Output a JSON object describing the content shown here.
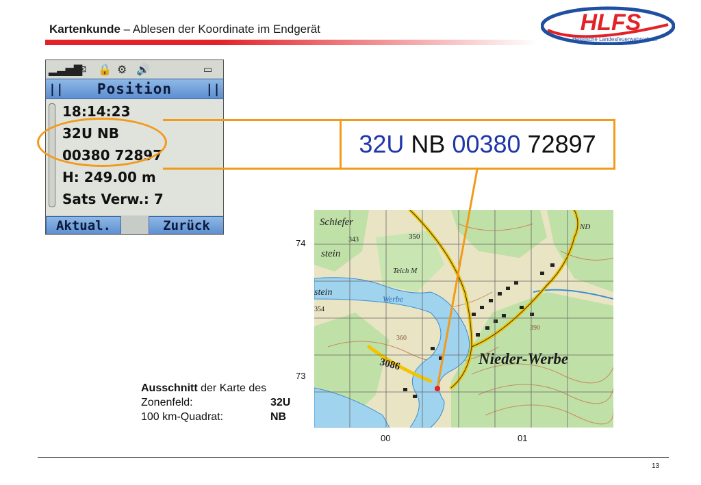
{
  "header": {
    "title_bold": "Kartenkunde",
    "title_rest": " – Ablesen der Koordinate im Endgerät",
    "logo_text": "HLFS",
    "logo_subtitle": "Hessische Landesfeuerwehrschule"
  },
  "device": {
    "screen_title": "Position",
    "lines": [
      "18:14:23",
      "32U NB",
      "00380 72897",
      "H: 249.00 m",
      "Sats Verw.:  7"
    ],
    "softkey_left": "Aktual.",
    "softkey_right": "Zurück",
    "status_icons": [
      "signal-icon",
      "message-icon",
      "lock-icon",
      "settings-icon",
      "speaker-icon",
      "battery-icon"
    ]
  },
  "coordinate": {
    "zone": "32U",
    "square": "NB",
    "easting": "00380",
    "northing": "72897"
  },
  "map": {
    "y_labels": [
      "74",
      "73"
    ],
    "x_labels": [
      "00",
      "01"
    ],
    "place_name": "Nieder-Werbe",
    "labels": [
      "Schiefer",
      "343",
      "350",
      "stein",
      "Teich M",
      "Werbe",
      "stein",
      "354",
      "3086",
      "ND",
      "360",
      "390"
    ]
  },
  "caption": {
    "line1_bold": "Ausschnitt",
    "line1_rest": " der Karte des",
    "zone_label": "Zonenfeld:",
    "zone_value": "32U",
    "square_label": "100 km-Quadrat:",
    "square_value": "NB"
  },
  "footer": {
    "page_number": "13"
  },
  "colors": {
    "accent_orange": "#f29a1a",
    "coord_blue": "#1f37a8",
    "brand_red": "#e32228",
    "brand_blue": "#1f4fa0"
  }
}
